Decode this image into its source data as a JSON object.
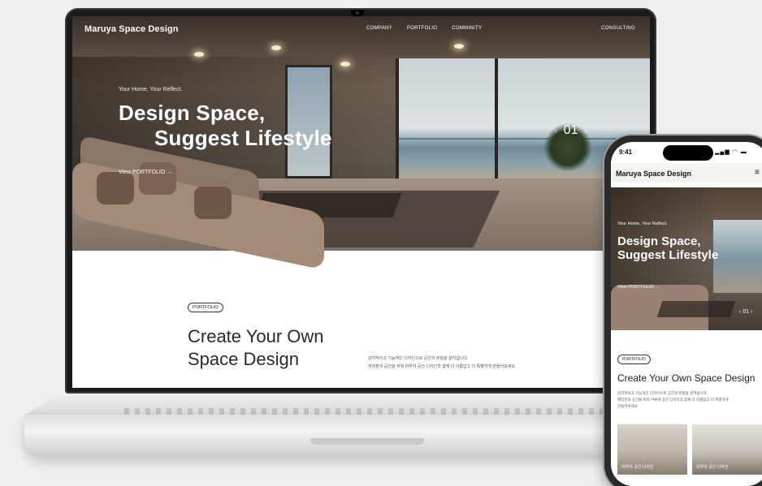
{
  "site": {
    "logo": "Maruya Space Design",
    "nav": [
      "COMPANY",
      "PORTFOLIO",
      "COMMINITY"
    ],
    "consulting": "CONSULTING"
  },
  "hero": {
    "tagline": "Your Home, Your Reflect.",
    "title_line1": "Design Space,",
    "title_line2": "Suggest Lifestyle",
    "link": "View PORTFOLIO →",
    "slide_number": "01",
    "prev_arrow": "‹",
    "next_arrow": "›"
  },
  "portfolio": {
    "badge": "PORTFOLIO",
    "heading_line1": "Create Your Own",
    "heading_line2": "Space Design",
    "desc_line1": "감각적이고 기능적인 디자인으로 공간의 본질을 살려냅니다.",
    "desc_line2": "여러분의 공간을 저희 마루야 공간 디자인과 함께 더 아름답고 더 특별하게 만들어보세요."
  },
  "phone": {
    "time": "9:41",
    "status_icons": "▂▄▆ ◠ ▬",
    "logo": "Maruya Space Design",
    "menu": "≡",
    "tagline": "Your Home, Your Reflect.",
    "title_line1": "Design Space,",
    "title_line2": "Suggest Lifestyle",
    "link": "View PORTFOLIO →",
    "pager": "‹ 01 ›",
    "badge": "PORTFOLIO",
    "section_title": "Create Your Own Space Design",
    "desc_line1": "감각적이고 기능적인 디자인으로 공간의 본질을 살려냅니다.",
    "desc_line2": "여러분의 공간을 저희 마루야 공간 디자인과 함께 더 아름답고 더 특별하게",
    "desc_line3": "만들어보세요.",
    "cards": [
      "마루야 공간 디자인",
      "마루야 공간 디자인"
    ]
  }
}
